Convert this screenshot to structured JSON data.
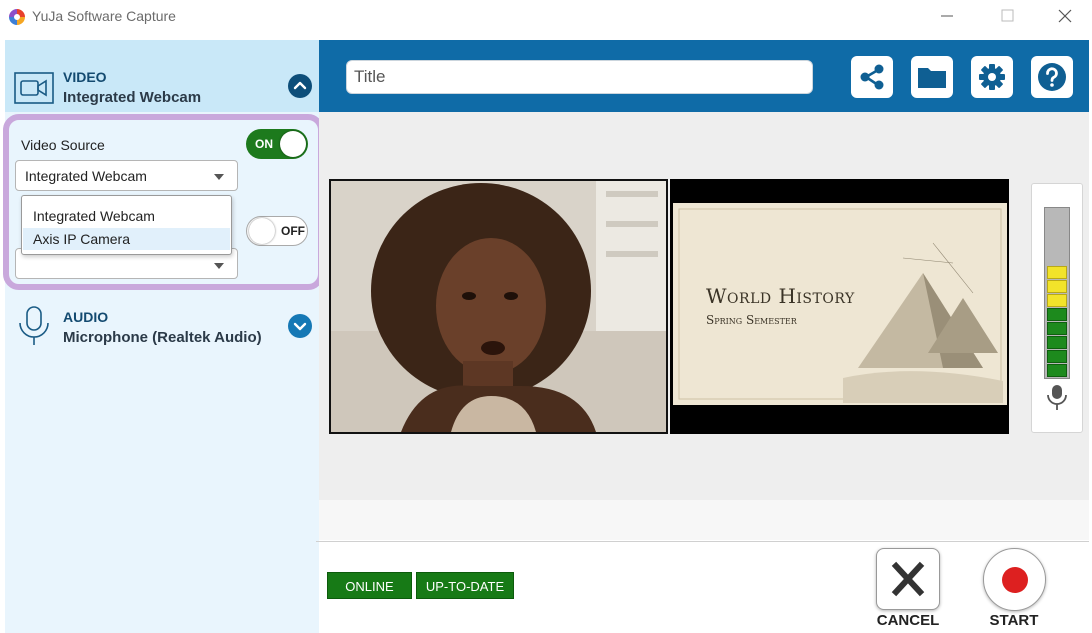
{
  "window": {
    "title": "YuJa Software Capture"
  },
  "sidebar": {
    "video": {
      "title": "VIDEO",
      "subtitle": "Integrated Webcam",
      "source_label": "Video Source",
      "toggle_on": "ON",
      "selected_source": "Integrated Webcam",
      "dropdown_options": [
        "Integrated Webcam",
        "Axis IP Camera"
      ],
      "toggle_off": "OFF"
    },
    "audio": {
      "title": "AUDIO",
      "subtitle": "Microphone (Realtek Audio)"
    }
  },
  "toolbar": {
    "title_placeholder": "Title",
    "icons": [
      "share-icon",
      "folder-icon",
      "gear-icon",
      "help-icon"
    ]
  },
  "preview": {
    "slide_title": "World History",
    "slide_subtitle": "Spring Semester",
    "audio_level_segments_lit": 8,
    "audio_level_segments_total": 13
  },
  "status": {
    "online": "ONLINE",
    "up_to_date": "UP-TO-DATE"
  },
  "actions": {
    "cancel": "CANCEL",
    "start": "START"
  },
  "colors": {
    "accent": "#0f6ba7",
    "toggle_on": "#1d7a1d",
    "highlight_outline": "#c9a8dc",
    "record_red": "#dd2020"
  }
}
